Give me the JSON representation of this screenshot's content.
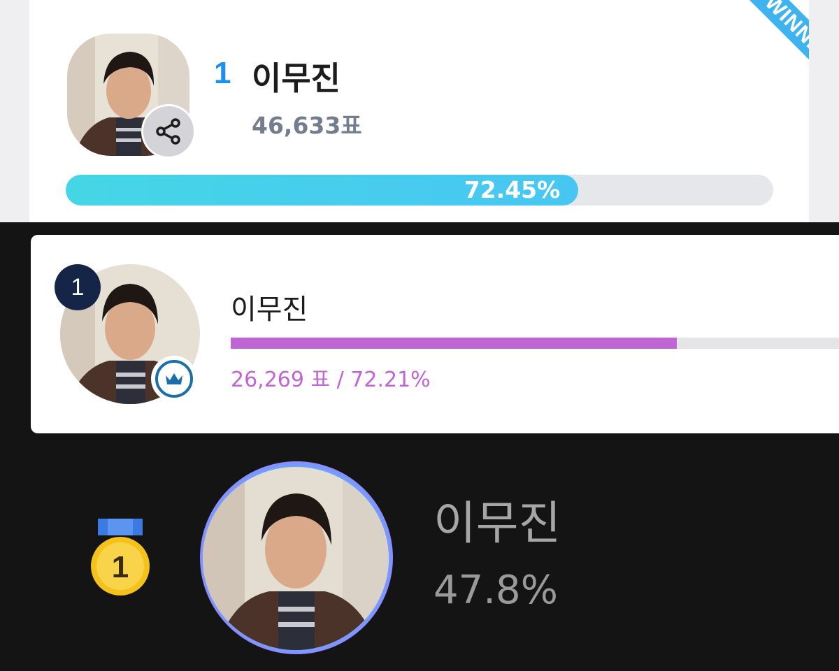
{
  "panel1": {
    "ribbon_label": "WINNER",
    "rank": "1",
    "name": "이무진",
    "votes": "46,633표",
    "percent_label": "72.45%",
    "percent_value": 72.45,
    "share_icon": "share-icon",
    "bar_color": "#48c6f2",
    "rank_color": "#1e8fef"
  },
  "panel2": {
    "rank": "1",
    "name": "이무진",
    "stats": "26,269 표 / 72.21%",
    "percent_value": 72.21,
    "badge_icon": "crown-icon",
    "bar_color": "#c164d5"
  },
  "panel3": {
    "medal_rank": "1",
    "medal_icon": "gold-medal-icon",
    "name": "이무진",
    "percent_label": "47.8%"
  }
}
